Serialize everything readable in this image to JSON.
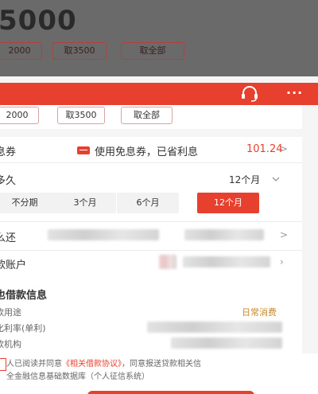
{
  "background": {
    "amount": "5000",
    "chips": [
      "2000",
      "取3500",
      "取全部"
    ]
  },
  "colors": {
    "accent": "#e8402e",
    "purpose": "#c98a2a"
  },
  "header": {
    "icons": [
      "headset-icon",
      "more-icon"
    ],
    "more_label": "···"
  },
  "quick_amounts": [
    "2000",
    "取3500",
    "取全部"
  ],
  "voucher": {
    "label": "息券",
    "text": "使用免息券，已省利息",
    "amount": "101.24"
  },
  "term": {
    "label": "多久",
    "value": "12个月",
    "options": [
      {
        "label": "不分期",
        "selected": false
      },
      {
        "label": "3个月",
        "selected": false
      },
      {
        "label": "6个月",
        "selected": false
      },
      {
        "label": "12个月",
        "selected": true
      }
    ]
  },
  "repay": {
    "label": "么还"
  },
  "account": {
    "label": "款账户"
  },
  "loan_info": {
    "title": "也借款信息",
    "purpose_label": "款用途",
    "purpose_value": "日常消费",
    "rate_label": "化利率(单利)",
    "institution_label": "款机构"
  },
  "agreement": {
    "text_pre": "人已阅读并同意",
    "link": "《相关借款协议》",
    "text_post": "，同意报送贷款相关信",
    "line2": "全金融信息基础数据库（个人征信系统）"
  }
}
